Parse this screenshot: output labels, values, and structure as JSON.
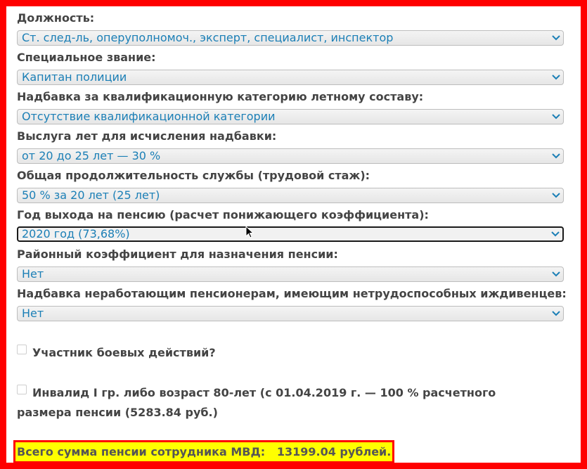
{
  "form": {
    "position": {
      "label": "Должность:",
      "value": "Ст. след-ль, оперуполномоч., эксперт, специалист, инспектор"
    },
    "rank": {
      "label": "Специальное звание:",
      "value": "Капитан полиции"
    },
    "qualification": {
      "label": "Надбавка за квалификационную категорию летному составу:",
      "value": "Отсутствие квалификационной категории"
    },
    "seniority_bonus": {
      "label": "Выслуга лет для исчисления надбавки:",
      "value": "от 20 до 25 лет — 30 %"
    },
    "total_service": {
      "label": "Общая продолжительность службы (трудовой стаж):",
      "value": "50 % за 20 лет (25 лет)"
    },
    "retirement_year": {
      "label": "Год выхода на пенсию (расчет понижающего коэффициента):",
      "value": "2020 год (73,68%)"
    },
    "regional_coefficient": {
      "label": "Районный коэффициент для назначения пенсии:",
      "value": "Нет"
    },
    "dependents_bonus": {
      "label": "Надбавка неработающим пенсионерам, имеющим нетрудоспособных иждивенцев:",
      "value": "Нет"
    }
  },
  "checkboxes": {
    "combat_veteran": {
      "label": "Участник боевых действий?",
      "checked": false
    },
    "disabled_or_80": {
      "label": "Инвалид I гр. либо возраст 80-лет (с 01.04.2019 г. — 100 % расчетного размера пенсии (5283.84 руб.)",
      "checked": false
    }
  },
  "total": {
    "text": "Всего сумма пенсии сотрудника МВД:   13199.04 рублей."
  },
  "colors": {
    "frame_border": "#ff0000",
    "select_text": "#1b7fb6",
    "label_text": "#444444",
    "total_background": "#ffff00",
    "total_border": "#ff0000"
  }
}
